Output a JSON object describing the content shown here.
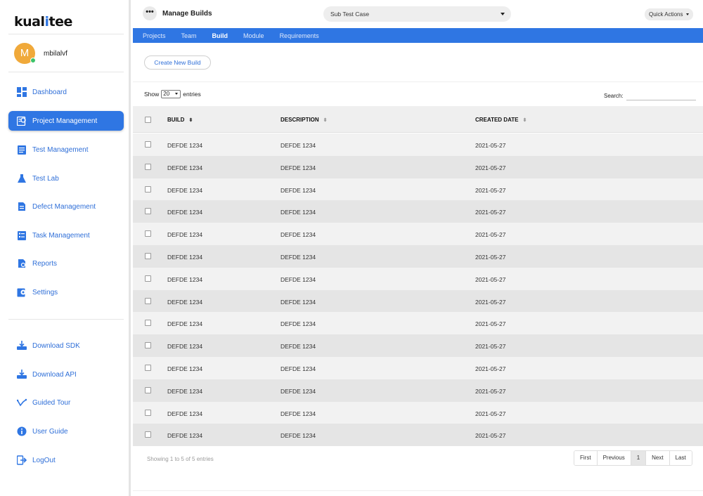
{
  "brand": {
    "logo_pre": "kual",
    "logo_dot": "i",
    "logo_post": "tee"
  },
  "user": {
    "initial": "M",
    "name": "mbilalvf"
  },
  "sidebar": {
    "items": [
      {
        "label": "Dashboard",
        "icon": "dashboard-icon"
      },
      {
        "label": "Project Management",
        "icon": "project-icon",
        "active": true
      },
      {
        "label": "Test Management",
        "icon": "test-management-icon"
      },
      {
        "label": "Test Lab",
        "icon": "flask-icon"
      },
      {
        "label": "Defect Management",
        "icon": "defect-icon"
      },
      {
        "label": "Task Management",
        "icon": "task-icon"
      },
      {
        "label": "Reports",
        "icon": "reports-icon"
      },
      {
        "label": "Settings",
        "icon": "settings-icon"
      }
    ],
    "bottom_items": [
      {
        "label": "Download SDK",
        "icon": "download-sdk-icon"
      },
      {
        "label": "Download API",
        "icon": "download-api-icon"
      },
      {
        "label": "Guided Tour",
        "icon": "tour-icon"
      },
      {
        "label": "User Guide",
        "icon": "info-icon"
      },
      {
        "label": "LogOut",
        "icon": "logout-icon"
      }
    ]
  },
  "header": {
    "more": "•••",
    "title": "Manage Builds",
    "sub_select": "Sub Test Case",
    "quick_actions": "Quick Actions"
  },
  "tabs": [
    {
      "label": "Projects"
    },
    {
      "label": "Team"
    },
    {
      "label": "Build",
      "active": true
    },
    {
      "label": "Module"
    },
    {
      "label": "Requirements"
    }
  ],
  "toolbar": {
    "create_label": "Create New Build",
    "show_label": "Show",
    "entries_value": "20",
    "entries_label": "entries",
    "search_label": "Search:"
  },
  "table": {
    "columns": [
      "BUILD",
      "DESCRIPTION",
      "CREATED DATE"
    ],
    "rows": [
      [
        "DEFDE 1234",
        "DEFDE 1234",
        "2021-05-27"
      ],
      [
        "DEFDE 1234",
        "DEFDE 1234",
        "2021-05-27"
      ],
      [
        "DEFDE 1234",
        "DEFDE 1234",
        "2021-05-27"
      ],
      [
        "DEFDE 1234",
        "DEFDE 1234",
        "2021-05-27"
      ],
      [
        "DEFDE 1234",
        "DEFDE 1234",
        "2021-05-27"
      ],
      [
        "DEFDE 1234",
        "DEFDE 1234",
        "2021-05-27"
      ],
      [
        "DEFDE 1234",
        "DEFDE 1234",
        "2021-05-27"
      ],
      [
        "DEFDE 1234",
        "DEFDE 1234",
        "2021-05-27"
      ],
      [
        "DEFDE 1234",
        "DEFDE 1234",
        "2021-05-27"
      ],
      [
        "DEFDE 1234",
        "DEFDE 1234",
        "2021-05-27"
      ],
      [
        "DEFDE 1234",
        "DEFDE 1234",
        "2021-05-27"
      ],
      [
        "DEFDE 1234",
        "DEFDE 1234",
        "2021-05-27"
      ],
      [
        "DEFDE 1234",
        "DEFDE 1234",
        "2021-05-27"
      ],
      [
        "DEFDE 1234",
        "DEFDE 1234",
        "2021-05-27"
      ]
    ]
  },
  "footer": {
    "info": "Showing 1 to 5 of 5 entries",
    "pager": [
      "First",
      "Previous",
      "1",
      "Next",
      "Last"
    ],
    "current_page": "1"
  },
  "colors": {
    "accent": "#2f76e3",
    "avatar": "#f0a93a",
    "online": "#3cc36a"
  }
}
